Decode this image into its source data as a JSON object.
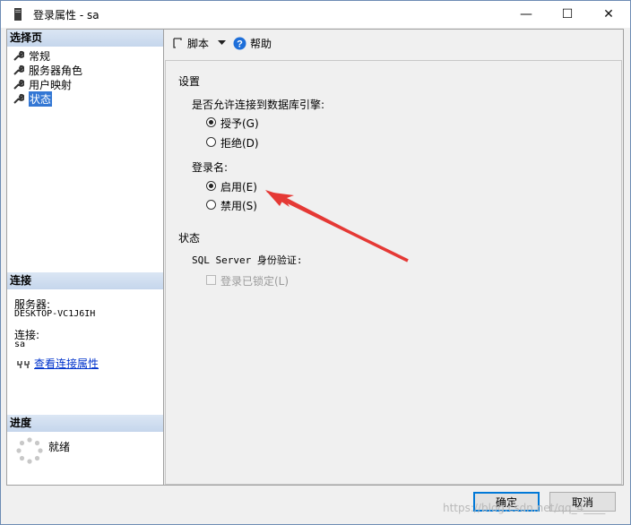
{
  "window": {
    "title": "登录属性 - sa",
    "minimize_glyph": "—",
    "maximize_glyph": "☐",
    "close_glyph": "✕"
  },
  "left": {
    "select_page_header": "选择页",
    "nav_items": [
      {
        "label": "常规",
        "icon": "wrench-icon"
      },
      {
        "label": "服务器角色",
        "icon": "wrench-icon"
      },
      {
        "label": "用户映射",
        "icon": "wrench-icon"
      },
      {
        "label": "状态",
        "icon": "wrench-icon",
        "selected": true
      }
    ],
    "connection_header": "连接",
    "server_label": "服务器:",
    "server_value": "DESKTOP-VC1J6IH",
    "connection_label": "连接:",
    "connection_value": "sa",
    "view_conn_props": "查看连接属性",
    "progress_header": "进度",
    "progress_status": "就绪"
  },
  "toolbar": {
    "script_label": "脚本",
    "help_label": "帮助"
  },
  "settings": {
    "section_label": "设置",
    "permission_question": "是否允许连接到数据库引擎:",
    "grant_label": "授予(G)",
    "deny_label": "拒绝(D)",
    "login_label": "登录名:",
    "enable_label": "启用(E)",
    "disable_label": "禁用(S)",
    "permission_value": "授予(G)",
    "login_value": "启用(E)"
  },
  "status": {
    "section_label": "状态",
    "auth_label": "SQL Server 身份验证:",
    "locked_label": "登录已锁定(L)",
    "locked_checked": false
  },
  "footer": {
    "ok_label": "确定",
    "cancel_label": "取消"
  },
  "watermark": "https://blog.csdn.net/qq_4____",
  "colors": {
    "selection": "#3377d4",
    "header_gradient": "#c5d6ec",
    "annotation_arrow": "#e53935",
    "help_icon": "#1e6fd9"
  }
}
